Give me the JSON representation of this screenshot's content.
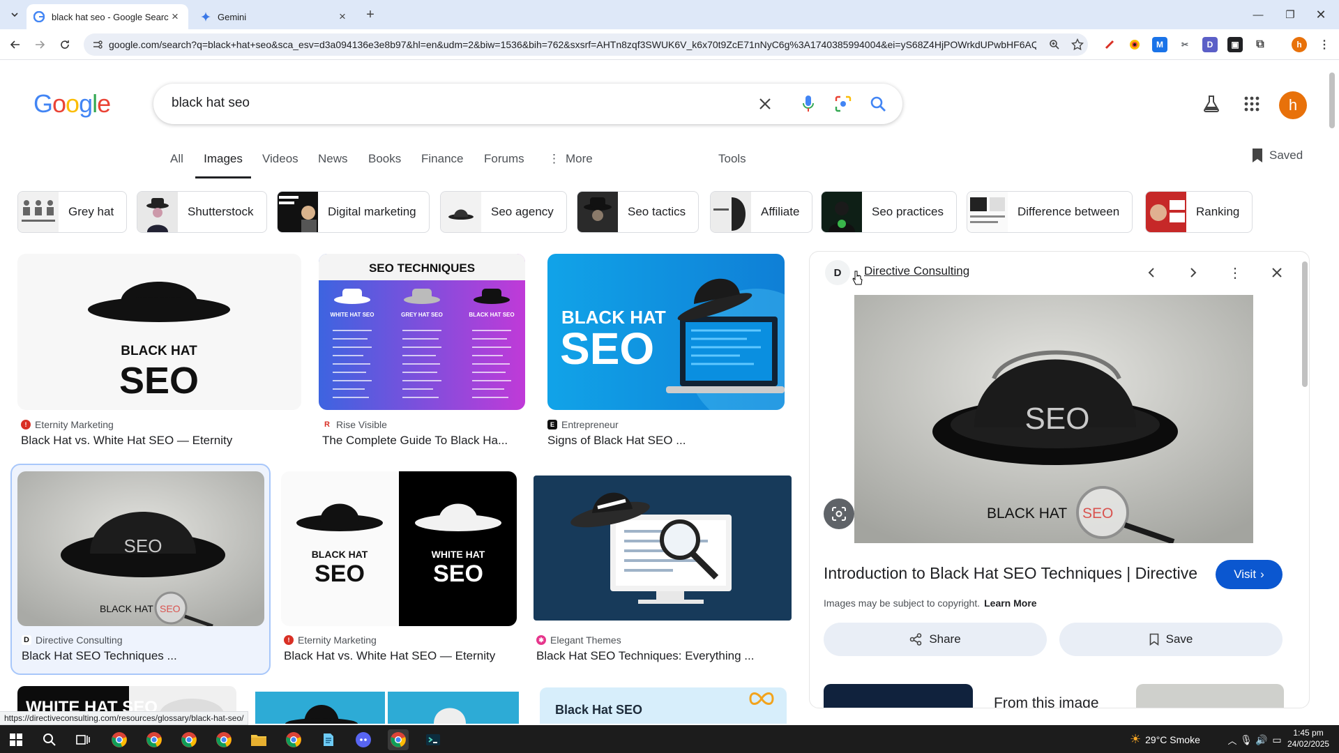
{
  "browser": {
    "tabs": [
      {
        "title": "black hat seo - Google Search",
        "active": true
      },
      {
        "title": "Gemini",
        "active": false
      }
    ],
    "url": "google.com/search?q=black+hat+seo&sca_esv=d3a094136e3e8b97&hl=en&udm=2&biw=1536&bih=762&sxsrf=AHTn8zqf3SWUK6V_k6x70t9ZcE71nNyC6g%3A1740385994004&ei=yS68Z4HjPOWrkdUPwbHF6AQ..."
  },
  "search": {
    "logo": "Google",
    "query": "black hat seo"
  },
  "nav_tabs": [
    "All",
    "Images",
    "Videos",
    "News",
    "Books",
    "Finance",
    "Forums",
    "More",
    "Tools"
  ],
  "selected_tab": "Images",
  "saved_label": "Saved",
  "avatar_letter": "h",
  "chips": [
    "Grey hat",
    "Shutterstock",
    "Digital marketing",
    "Seo agency",
    "Seo tactics",
    "Affiliate",
    "Seo practices",
    "Difference between",
    "Ranking"
  ],
  "results": [
    {
      "source": "Eternity Marketing",
      "title": "Black Hat vs. White Hat SEO — Eternity",
      "img_text": [
        "BLACK HAT",
        "SEO"
      ]
    },
    {
      "source": "Rise Visible",
      "title": "The Complete Guide To Black Ha...",
      "img_text": [
        "SEO TECHNIQUES",
        "WHITE HAT SEO",
        "GREY HAT SEO",
        "BLACK HAT SEO"
      ]
    },
    {
      "source": "Entrepreneur",
      "title": "Signs of Black Hat SEO ...",
      "img_text": [
        "BLACK HAT",
        "SEO"
      ]
    },
    {
      "source": "Directive Consulting",
      "title": "Black Hat SEO Techniques ...",
      "img_text": [
        "SEO",
        "BLACK HAT",
        "SEO"
      ]
    },
    {
      "source": "Eternity Marketing",
      "title": "Black Hat vs. White Hat SEO — Eternity",
      "img_text": [
        "BLACK HAT",
        "SEO",
        "WHITE HAT",
        "SEO"
      ]
    },
    {
      "source": "Elegant Themes",
      "title": "Black Hat SEO Techniques: Everything ...",
      "img_text": []
    }
  ],
  "partial_results": [
    "WHITE HAT SEO",
    "Black Hat SEO"
  ],
  "panel": {
    "source": "Directive Consulting",
    "image_text": [
      "SEO",
      "BLACK HAT",
      "SEO"
    ],
    "title": "Introduction to Black Hat SEO Techniques | Directive",
    "visit_label": "Visit",
    "copyright": "Images may be subject to copyright.",
    "learn_more": "Learn More",
    "share_label": "Share",
    "save_label": "Save",
    "from_image": "From this image"
  },
  "status_url": "https://directiveconsulting.com/resources/glossary/black-hat-seo/",
  "taskbar": {
    "weather": "29°C  Smoke",
    "time": "1:45 pm",
    "date": "24/02/2025"
  }
}
